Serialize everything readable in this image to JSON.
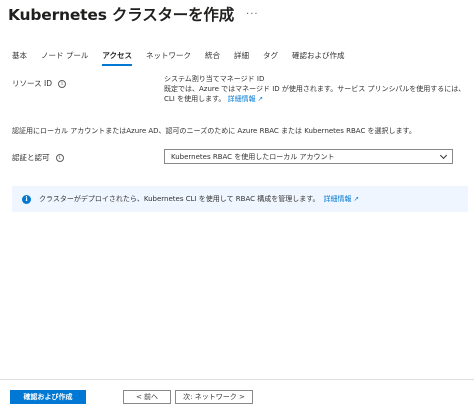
{
  "header": {
    "title": "Kubernetes クラスターを作成",
    "more": "···"
  },
  "tabs": [
    {
      "label": "基本"
    },
    {
      "label": "ノード プール"
    },
    {
      "label": "アクセス"
    },
    {
      "label": "ネットワーク"
    },
    {
      "label": "統合"
    },
    {
      "label": "詳細"
    },
    {
      "label": "タグ"
    },
    {
      "label": "確認および作成"
    }
  ],
  "resource_identity": {
    "label": "リソース ID",
    "value_title": "システム割り当てマネージド ID",
    "value_text": "既定では、Azure ではマネージド ID が使用されます。サービス プリンシパルを使用するには、CLI を使用します。",
    "link": "詳細情報"
  },
  "auth_description": "認証用にローカル アカウントまたはAzure AD、認可のニーズのために Azure RBAC または Kubernetes RBAC を選択します。",
  "auth": {
    "label": "認証と認可",
    "selected": "Kubernetes RBAC を使用したローカル アカウント"
  },
  "banner": {
    "text": "クラスターがデプロイされたら、Kubernetes CLI を使用して RBAC 構成を管理します。",
    "link": "詳細情報"
  },
  "footer": {
    "review_create": "確認および作成",
    "prev": "< 前へ",
    "next": "次: ネットワーク >"
  },
  "colors": {
    "accent": "#0078d4",
    "banner_bg": "#f0f6ff"
  },
  "active_tab_index": 2
}
